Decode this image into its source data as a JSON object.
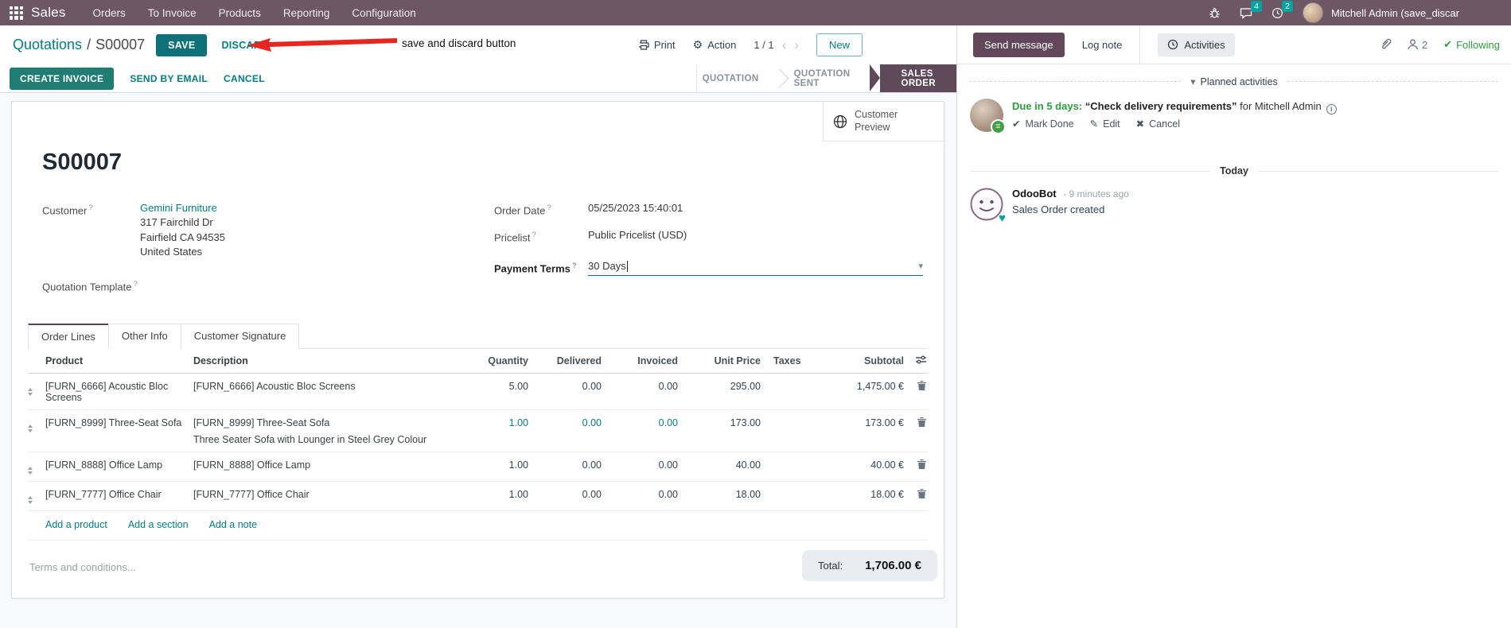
{
  "colors": {
    "topbar": "#6d5765",
    "accent_teal": "#017e84",
    "active_stage_purple": "#5f4a59",
    "send_message_purple": "#62475a",
    "badge_teal": "#00a3a0",
    "green": "#2e9e3e",
    "annotation_red": "#e8251f"
  },
  "topbar": {
    "app": "Sales",
    "menus": [
      "Orders",
      "To Invoice",
      "Products",
      "Reporting",
      "Configuration"
    ],
    "message_badge": "4",
    "activity_badge": "2",
    "user": "Mitchell Admin (save_discar"
  },
  "control": {
    "breadcrumb_parent": "Quotations",
    "breadcrumb_sep": "/",
    "breadcrumb_current": "S00007",
    "save": "SAVE",
    "discard": "DISCARD",
    "annotation": "save and discard button",
    "print": "Print",
    "action": "Action",
    "pager": "1 / 1",
    "new": "New"
  },
  "statusbar": {
    "buttons": [
      "CREATE INVOICE",
      "SEND BY EMAIL",
      "CANCEL"
    ],
    "stages": [
      "QUOTATION",
      "QUOTATION SENT",
      "SALES ORDER"
    ],
    "active_stage": "SALES ORDER"
  },
  "sheet": {
    "preview_label": "Customer Preview",
    "reference": "S00007",
    "help_marker": "?",
    "customer": {
      "label": "Customer",
      "name": "Gemini Furniture",
      "address": [
        "317 Fairchild Dr",
        "Fairfield CA 94535",
        "United States"
      ]
    },
    "quotation_template_label": "Quotation Template",
    "order_date": {
      "label": "Order Date",
      "value": "05/25/2023 15:40:01"
    },
    "pricelist": {
      "label": "Pricelist",
      "value": "Public Pricelist (USD)"
    },
    "payment_terms": {
      "label": "Payment Terms",
      "value": "30 Days"
    },
    "tabs": [
      "Order Lines",
      "Other Info",
      "Customer Signature"
    ],
    "lines": {
      "headers": {
        "product": "Product",
        "description": "Description",
        "quantity": "Quantity",
        "delivered": "Delivered",
        "invoiced": "Invoiced",
        "unit_price": "Unit Price",
        "taxes": "Taxes",
        "subtotal": "Subtotal"
      },
      "rows": [
        {
          "product": "[FURN_6666] Acoustic Bloc Screens",
          "description": "[FURN_6666] Acoustic Bloc Screens",
          "description2": "",
          "quantity": "5.00",
          "delivered": "0.00",
          "invoiced": "0.00",
          "unit_price": "295.00",
          "subtotal": "1,475.00 €"
        },
        {
          "product": "[FURN_8999] Three-Seat Sofa",
          "description": "[FURN_8999] Three-Seat Sofa",
          "description2": "Three Seater Sofa with Lounger in Steel Grey Colour",
          "quantity": "1.00",
          "delivered": "0.00",
          "invoiced": "0.00",
          "unit_price": "173.00",
          "subtotal": "173.00 €"
        },
        {
          "product": "[FURN_8888] Office Lamp",
          "description": "[FURN_8888] Office Lamp",
          "description2": "",
          "quantity": "1.00",
          "delivered": "0.00",
          "invoiced": "0.00",
          "unit_price": "40.00",
          "subtotal": "40.00 €"
        },
        {
          "product": "[FURN_7777] Office Chair",
          "description": "[FURN_7777] Office Chair",
          "description2": "",
          "quantity": "1.00",
          "delivered": "0.00",
          "invoiced": "0.00",
          "unit_price": "18.00",
          "subtotal": "18.00 €"
        }
      ],
      "links": [
        "Add a product",
        "Add a section",
        "Add a note"
      ]
    },
    "terms_placeholder": "Terms and conditions...",
    "total_label": "Total:",
    "total_value": "1,706.00 €"
  },
  "chatter": {
    "send_message": "Send message",
    "log_note": "Log note",
    "activities": "Activities",
    "followers_count": "2",
    "following": "Following",
    "planned": {
      "header": "Planned activities",
      "due": "Due in 5 days:",
      "summary": "“Check delivery requirements”",
      "assignee": "for Mitchell Admin",
      "mark_done": "Mark Done",
      "edit": "Edit",
      "cancel": "Cancel"
    },
    "today": "Today",
    "message": {
      "author": "OdooBot",
      "time": "- 9 minutes ago",
      "body": "Sales Order created"
    }
  },
  "icons": {
    "check": "✔",
    "edit": "✎",
    "cancel": "✖",
    "caret_down": "▾",
    "chevron_left": "‹",
    "chevron_right": "›",
    "heart": "♥",
    "gear": "⚙",
    "menu_lines": "≡",
    "info": "i"
  }
}
